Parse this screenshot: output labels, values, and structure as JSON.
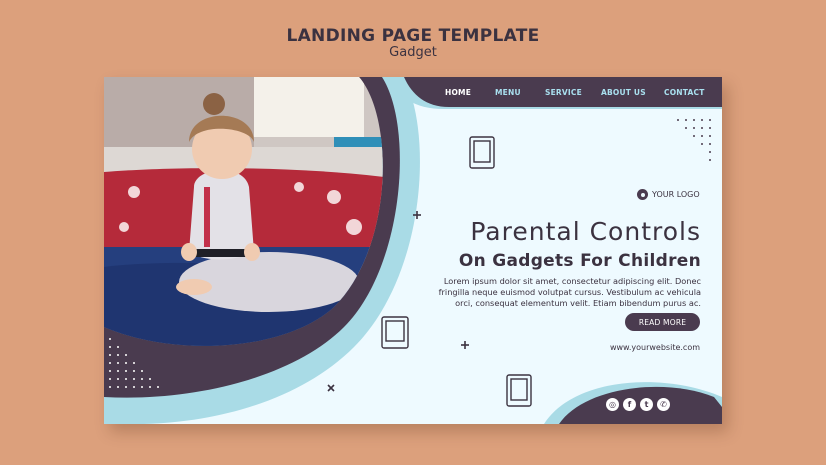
{
  "header": {
    "title": "LANDING PAGE TEMPLATE",
    "subtitle": "Gadget"
  },
  "nav": {
    "items": [
      {
        "label": "HOME",
        "active": true
      },
      {
        "label": "MENU",
        "active": false
      },
      {
        "label": "SERVICE",
        "active": false
      },
      {
        "label": "ABOUT US",
        "active": false
      },
      {
        "label": "CONTACT",
        "active": false
      }
    ]
  },
  "brand": {
    "logo_text": "YOUR LOGO"
  },
  "hero": {
    "headline": "Parental Controls",
    "subheadline": "On Gadgets For Children",
    "body": "Lorem ipsum dolor sit amet, consectetur adipiscing elit. Donec fringilla neque euismod volutpat cursus. Vestibulum ac vehicula orci, consequat elementum velit. Etiam bibendum purus ac.",
    "cta_label": "READ MORE",
    "website": "www.yourwebsite.com"
  },
  "social": [
    "instagram-icon",
    "facebook-icon",
    "twitter-icon",
    "whatsapp-icon"
  ],
  "colors": {
    "background": "#dca07c",
    "dark": "#4a3b4f",
    "light_blue": "#a9dbe6",
    "card": "#eefaff"
  }
}
